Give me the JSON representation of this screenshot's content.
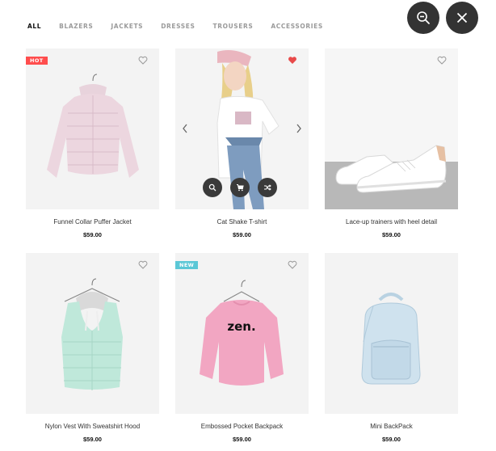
{
  "filters": {
    "all": "ALL",
    "blazers": "BLAZERS",
    "jackets": "JACKETS",
    "dresses": "DRESSES",
    "trousers": "TROUSERS",
    "accessories": "ACCESSORIES"
  },
  "controls": {
    "zoom_out_icon": "zoom-out",
    "close_icon": "close"
  },
  "products": [
    {
      "name": "Funnel Collar Puffer Jacket",
      "price": "$59.00",
      "badge": "HOT",
      "badge_color": "#ff4d4d",
      "favorited": false
    },
    {
      "name": "Cat Shake T-shirt",
      "price": "$59.00",
      "badge": "",
      "favorited": true,
      "heart_color": "#e84a4a"
    },
    {
      "name": "Lace-up trainers with heel detail",
      "price": "$59.00",
      "badge": "",
      "favorited": false
    },
    {
      "name": "Nylon Vest With Sweatshirt Hood",
      "price": "$59.00",
      "badge": "",
      "favorited": false
    },
    {
      "name": "Embossed Pocket Backpack",
      "price": "$59.00",
      "badge": "NEW",
      "badge_color": "#5bc7d6",
      "favorited": false
    },
    {
      "name": "Mini BackPack",
      "price": "$59.00",
      "badge": "",
      "favorited": false
    }
  ],
  "sweatshirt_print": "zen."
}
